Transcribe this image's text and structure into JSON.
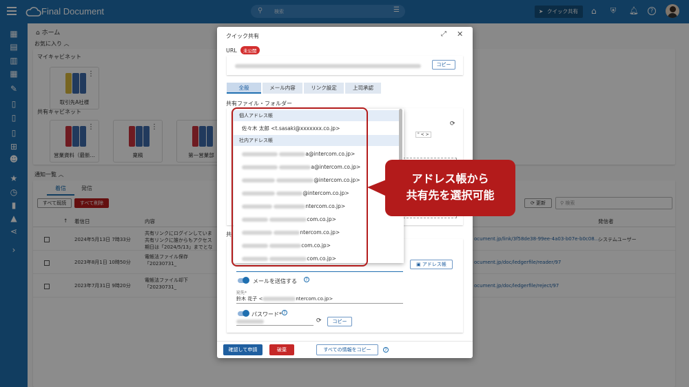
{
  "header": {
    "brand": "Final Document",
    "search_placeholder": "検索",
    "quick_share_label": "クイック共有"
  },
  "favorites": {
    "title": "お気に入り",
    "my_cabinet": "マイキャビネット",
    "shared_cabinet": "共有キャビネット",
    "my_folders": [
      {
        "name": "取引先A社様"
      }
    ],
    "shared_folders": [
      {
        "name": "営業資料（最新…"
      },
      {
        "name": "稟稿"
      },
      {
        "name": "第一営業部"
      }
    ]
  },
  "notifications": {
    "title": "通知一覧",
    "tabs": [
      "着信",
      "発信"
    ],
    "mark_all_read": "すべて既読",
    "delete_all": "すべて削除",
    "refresh": "更新",
    "search_placeholder": "検索",
    "columns": [
      "着信日",
      "内容",
      "発信者"
    ],
    "rows": [
      {
        "date": "2024年5月13日 7時33分",
        "content": [
          "共有リンクにログインしていま",
          "共有リンクに誰からもアクセス",
          "期日は「2024/5/13」までとな"
        ],
        "link": "ocument.jp/link/3f58de38-99ee-4a03-b07e-b0c08…",
        "sender": "システムユーザー"
      },
      {
        "date": "2023年8月1日 10時50分",
        "content": [
          "電帳法ファイル保存",
          "「20230731_"
        ],
        "link": "ocument.jp/doc/ledgerfile/reader/97",
        "sender": ""
      },
      {
        "date": "2023年7月31日 9時20分",
        "content": [
          "電帳法ファイル却下",
          "「20230731_"
        ],
        "link": "ocument.jp/doc/ledgerfile/reject/97",
        "sender": ""
      }
    ]
  },
  "modal": {
    "title": "クイック共有",
    "url_label": "URL",
    "unpublished_badge": "未公開",
    "copy_label": "コピー",
    "tabs": [
      "全般",
      "メール内容",
      "リンク設定",
      "上司承認"
    ],
    "shared_files_label": "共有ファイル・フォルダー",
    "share_prefix": "共",
    "address_book_button": "アドレス帳",
    "send_mail_label": "メールを送信する",
    "recipient_label": "宛先*",
    "recipient_value": "鈴木 花子 <",
    "recipient_domain": "ntercom.co.jp>",
    "password_label": "パスワード*",
    "password_copy": "コピー",
    "code_tag": "\" < >",
    "confirm_button": "確認して申請",
    "discard_button": "破棄",
    "copy_all_button": "すべての情報をコピー"
  },
  "dropdown": {
    "personal_header": "個人アドレス帳",
    "personal_entry": "佐々木 太郎 <t.sasaki@xxxxxxx.co.jp>",
    "internal_header": "社内アドレス帳",
    "entries": [
      "a@intercom.co.jp>",
      "a@intercom.co.jp>",
      "@intercom.co.jp>",
      "@intercom.co.jp>",
      "ntercom.co.jp>",
      "com.co.jp>",
      "ntercom.co.jp>",
      "com.co.jp>",
      "com.co.jp>",
      "intercom.co.jp>"
    ]
  },
  "callout": {
    "line1": "アドレス帳から",
    "line2": "共有先を選択可能"
  },
  "colors": {
    "primary": "#1f6fb0",
    "danger": "#b71c1c",
    "callout": "#b31b1b"
  }
}
